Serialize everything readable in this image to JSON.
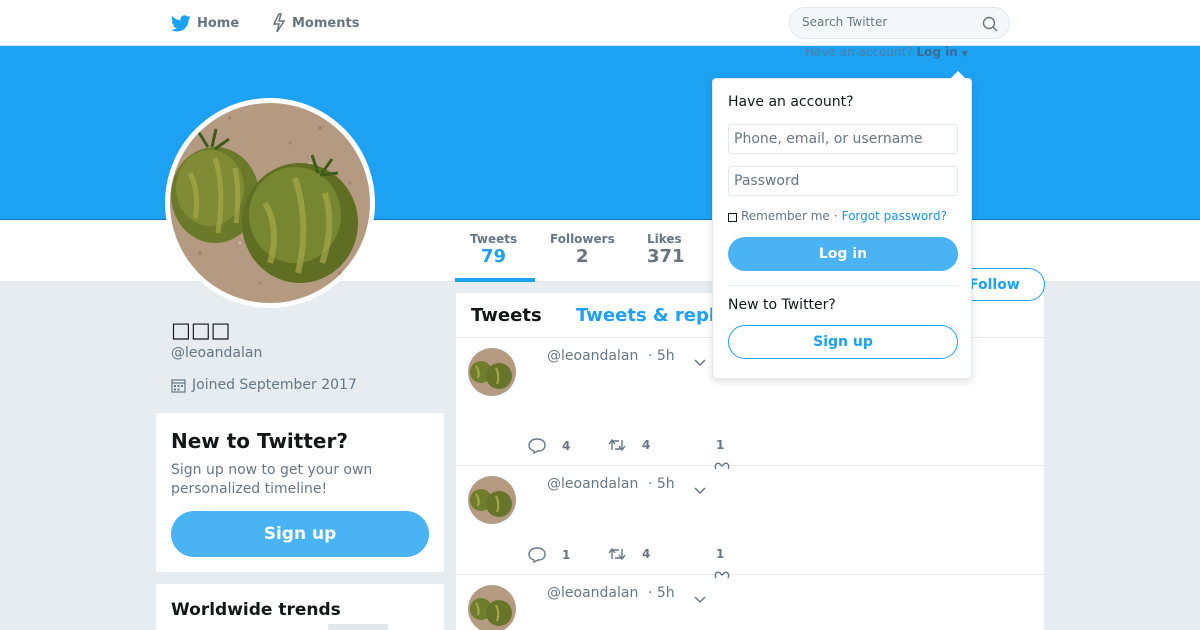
{
  "nav": {
    "home_label": "Home",
    "moments_label": "Moments",
    "search_placeholder": "Search Twitter",
    "have_account_text": "Have an account?",
    "login_link": "Log in"
  },
  "profile": {
    "display_name": "□□□",
    "handle": "@leoandalan",
    "joined": "Joined September 2017",
    "follow_label": "Follow"
  },
  "stats": [
    {
      "label": "Tweets",
      "value": "79"
    },
    {
      "label": "Followers",
      "value": "2"
    },
    {
      "label": "Likes",
      "value": "371"
    }
  ],
  "signup_card": {
    "title": "New to Twitter?",
    "text": "Sign up now to get your own personalized timeline!",
    "button": "Sign up"
  },
  "trends": {
    "title": "Worldwide trends"
  },
  "timeline": {
    "tab_tweets": "Tweets",
    "tab_replies": "Tweets & repl",
    "tweets": [
      {
        "handle": "@leoandalan",
        "time": "· 5h",
        "replies": "4",
        "retweets": "4",
        "likes": "1"
      },
      {
        "handle": "@leoandalan",
        "time": "· 5h",
        "replies": "1",
        "retweets": "4",
        "likes": "1"
      },
      {
        "handle": "@leoandalan",
        "time": "· 5h",
        "replies": "",
        "retweets": "",
        "likes": ""
      }
    ]
  },
  "login_dropdown": {
    "title": "Have an account?",
    "username_placeholder": "Phone, email, or username",
    "password_placeholder": "Password",
    "remember_me": "Remember me",
    "separator": "·",
    "forgot_password": "Forgot password?",
    "login_button": "Log in",
    "new_to_twitter": "New to Twitter?",
    "signup_button": "Sign up"
  },
  "colors": {
    "brand_blue": "#1da1f2",
    "button_blue": "#4ab3f4",
    "background": "#e6ecf0"
  },
  "icons": [
    "twitter-bird-icon",
    "moments-bolt-icon",
    "search-icon",
    "calendar-icon",
    "reply-icon",
    "retweet-icon",
    "heart-icon",
    "chevron-down-icon"
  ]
}
